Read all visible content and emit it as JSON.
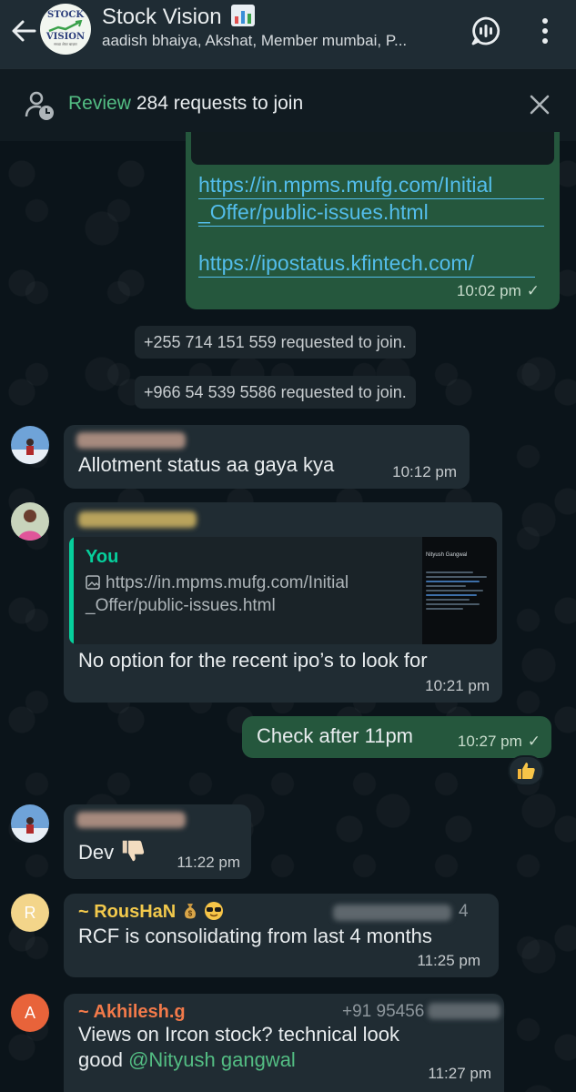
{
  "header": {
    "back_icon": "arrow-left-icon",
    "group_logo": {
      "line1": "STOCK",
      "line2": "VISION",
      "tagline": "सच्चा शेयर बाज़ार"
    },
    "title": "Stock Vision",
    "title_emoji": "bar-chart-icon",
    "members": "aadish bhaiya, Akshat, Member mumbai, P...",
    "call_icon": "voice-chat-icon",
    "menu_icon": "more-vert-icon"
  },
  "review_bar": {
    "link": "Review",
    "text": "284 requests to join",
    "icon": "person-clock-icon",
    "close_icon": "close-icon"
  },
  "messages": {
    "m1": {
      "link1_line1": "https://in.mpms.mufg.com/Initial",
      "link1_line2": "_Offer/public-issues.html",
      "link2": "https://ipostatus.kfintech.com/",
      "time": "10:02 pm"
    },
    "sys1": "+255 714 151 559 requested to join.",
    "sys2": "+966 54 539 5586 requested to join.",
    "m2": {
      "text": "Allotment status aa gaya kya",
      "time": "10:12 pm"
    },
    "m3": {
      "quote_author": "You",
      "quote_line1": "https://in.mpms.mufg.com/Initial",
      "quote_line2": "_Offer/public-issues.html",
      "quote_more": "...",
      "thumb_title": "Nityush Gangwal",
      "text": "No option for the recent ipo’s to look for",
      "time": "10:21 pm"
    },
    "m4": {
      "text": "Check after 11pm",
      "time": "10:27 pm",
      "reaction": "thumbs-up"
    },
    "m5": {
      "text": "Dev",
      "emoji": "thumbs-down-icon",
      "time": "11:22 pm"
    },
    "m6": {
      "avatar_letter": "R",
      "sender": "~ RousHaN",
      "sender_emojis": "money-bag, sunglasses",
      "phone_fragment": "4",
      "text": "RCF is consolidating from last 4 months",
      "time": "11:25 pm"
    },
    "m7": {
      "avatar_letter": "A",
      "sender": "~ Akhilesh.g",
      "phone_fragment": "+91 95456 ",
      "text_line1": "Views on Ircon stock? technical look",
      "text_line2_prefix": "good ",
      "mention": "@Nityush gangwal",
      "time": "11:27 pm"
    }
  },
  "colors": {
    "header_bg": "#1f2c34",
    "chat_bg": "#0b141a",
    "incoming_bubble": "#202c33",
    "outgoing_bubble": "#25573d",
    "accent_green": "#53bd83",
    "link_blue": "#53bdeb",
    "roushan_name": "#f2c94c",
    "akhilesh_name": "#f27a4a"
  }
}
